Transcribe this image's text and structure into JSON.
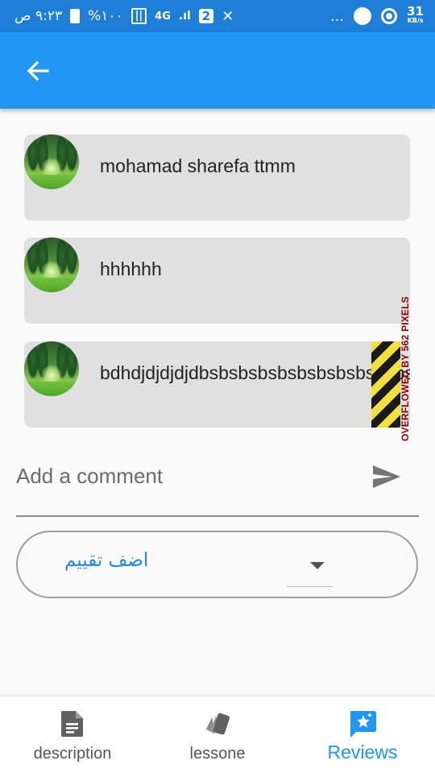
{
  "status_bar": {
    "time": "٩:٢٣ ص",
    "battery": "%١٠٠",
    "network": "4G",
    "notification_count": "2",
    "more": "...",
    "speed_value": "31",
    "speed_unit": "KB/s"
  },
  "app_bar": {
    "back_icon": "arrow-left-icon"
  },
  "comments": [
    {
      "text": "mohamad sharefa ttmm"
    },
    {
      "text": "hhhhhh"
    },
    {
      "text": "bdhdjdjdjdjdbsbsbsbsbsbsbsbsbsbsbsbs"
    }
  ],
  "overflow_warning": "OVERFLOWED BY 562 PIXELS",
  "comment_input": {
    "placeholder": "Add a comment",
    "value": ""
  },
  "rating": {
    "label": "اضف تقييم"
  },
  "bottom_nav": {
    "items": [
      {
        "label": "description",
        "icon": "document-icon"
      },
      {
        "label": "lessone",
        "icon": "cards-icon"
      },
      {
        "label": "Reviews",
        "icon": "review-star-icon",
        "active": true
      }
    ]
  },
  "colors": {
    "primary": "#2196f3",
    "status_bar": "#1e7ed8",
    "card_bg": "#e0e0e0",
    "overflow_label": "#8b0000",
    "active_nav": "#2196f3"
  }
}
